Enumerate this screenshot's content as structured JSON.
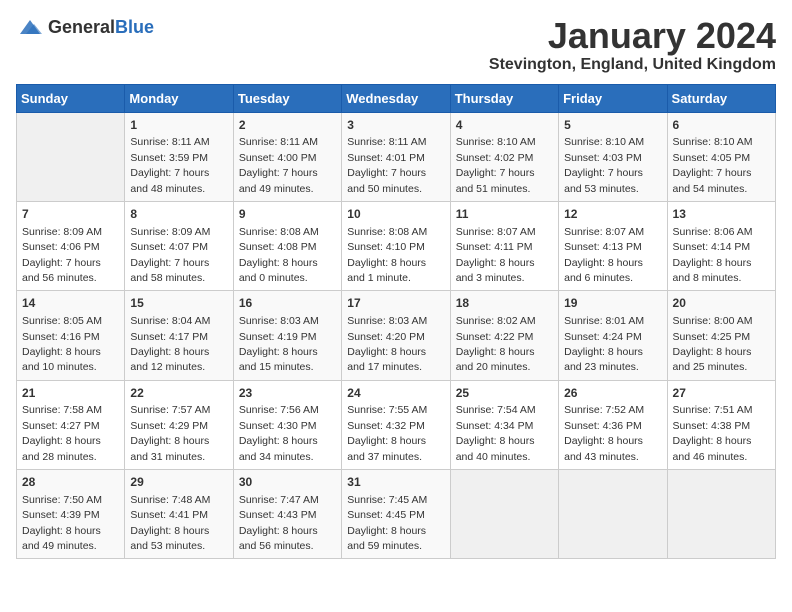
{
  "logo": {
    "general": "General",
    "blue": "Blue"
  },
  "header": {
    "month": "January 2024",
    "location": "Stevington, England, United Kingdom"
  },
  "days_of_week": [
    "Sunday",
    "Monday",
    "Tuesday",
    "Wednesday",
    "Thursday",
    "Friday",
    "Saturday"
  ],
  "weeks": [
    [
      {
        "day": "",
        "sunrise": "",
        "sunset": "",
        "daylight": ""
      },
      {
        "day": "1",
        "sunrise": "Sunrise: 8:11 AM",
        "sunset": "Sunset: 3:59 PM",
        "daylight": "Daylight: 7 hours and 48 minutes."
      },
      {
        "day": "2",
        "sunrise": "Sunrise: 8:11 AM",
        "sunset": "Sunset: 4:00 PM",
        "daylight": "Daylight: 7 hours and 49 minutes."
      },
      {
        "day": "3",
        "sunrise": "Sunrise: 8:11 AM",
        "sunset": "Sunset: 4:01 PM",
        "daylight": "Daylight: 7 hours and 50 minutes."
      },
      {
        "day": "4",
        "sunrise": "Sunrise: 8:10 AM",
        "sunset": "Sunset: 4:02 PM",
        "daylight": "Daylight: 7 hours and 51 minutes."
      },
      {
        "day": "5",
        "sunrise": "Sunrise: 8:10 AM",
        "sunset": "Sunset: 4:03 PM",
        "daylight": "Daylight: 7 hours and 53 minutes."
      },
      {
        "day": "6",
        "sunrise": "Sunrise: 8:10 AM",
        "sunset": "Sunset: 4:05 PM",
        "daylight": "Daylight: 7 hours and 54 minutes."
      }
    ],
    [
      {
        "day": "7",
        "sunrise": "Sunrise: 8:09 AM",
        "sunset": "Sunset: 4:06 PM",
        "daylight": "Daylight: 7 hours and 56 minutes."
      },
      {
        "day": "8",
        "sunrise": "Sunrise: 8:09 AM",
        "sunset": "Sunset: 4:07 PM",
        "daylight": "Daylight: 7 hours and 58 minutes."
      },
      {
        "day": "9",
        "sunrise": "Sunrise: 8:08 AM",
        "sunset": "Sunset: 4:08 PM",
        "daylight": "Daylight: 8 hours and 0 minutes."
      },
      {
        "day": "10",
        "sunrise": "Sunrise: 8:08 AM",
        "sunset": "Sunset: 4:10 PM",
        "daylight": "Daylight: 8 hours and 1 minute."
      },
      {
        "day": "11",
        "sunrise": "Sunrise: 8:07 AM",
        "sunset": "Sunset: 4:11 PM",
        "daylight": "Daylight: 8 hours and 3 minutes."
      },
      {
        "day": "12",
        "sunrise": "Sunrise: 8:07 AM",
        "sunset": "Sunset: 4:13 PM",
        "daylight": "Daylight: 8 hours and 6 minutes."
      },
      {
        "day": "13",
        "sunrise": "Sunrise: 8:06 AM",
        "sunset": "Sunset: 4:14 PM",
        "daylight": "Daylight: 8 hours and 8 minutes."
      }
    ],
    [
      {
        "day": "14",
        "sunrise": "Sunrise: 8:05 AM",
        "sunset": "Sunset: 4:16 PM",
        "daylight": "Daylight: 8 hours and 10 minutes."
      },
      {
        "day": "15",
        "sunrise": "Sunrise: 8:04 AM",
        "sunset": "Sunset: 4:17 PM",
        "daylight": "Daylight: 8 hours and 12 minutes."
      },
      {
        "day": "16",
        "sunrise": "Sunrise: 8:03 AM",
        "sunset": "Sunset: 4:19 PM",
        "daylight": "Daylight: 8 hours and 15 minutes."
      },
      {
        "day": "17",
        "sunrise": "Sunrise: 8:03 AM",
        "sunset": "Sunset: 4:20 PM",
        "daylight": "Daylight: 8 hours and 17 minutes."
      },
      {
        "day": "18",
        "sunrise": "Sunrise: 8:02 AM",
        "sunset": "Sunset: 4:22 PM",
        "daylight": "Daylight: 8 hours and 20 minutes."
      },
      {
        "day": "19",
        "sunrise": "Sunrise: 8:01 AM",
        "sunset": "Sunset: 4:24 PM",
        "daylight": "Daylight: 8 hours and 23 minutes."
      },
      {
        "day": "20",
        "sunrise": "Sunrise: 8:00 AM",
        "sunset": "Sunset: 4:25 PM",
        "daylight": "Daylight: 8 hours and 25 minutes."
      }
    ],
    [
      {
        "day": "21",
        "sunrise": "Sunrise: 7:58 AM",
        "sunset": "Sunset: 4:27 PM",
        "daylight": "Daylight: 8 hours and 28 minutes."
      },
      {
        "day": "22",
        "sunrise": "Sunrise: 7:57 AM",
        "sunset": "Sunset: 4:29 PM",
        "daylight": "Daylight: 8 hours and 31 minutes."
      },
      {
        "day": "23",
        "sunrise": "Sunrise: 7:56 AM",
        "sunset": "Sunset: 4:30 PM",
        "daylight": "Daylight: 8 hours and 34 minutes."
      },
      {
        "day": "24",
        "sunrise": "Sunrise: 7:55 AM",
        "sunset": "Sunset: 4:32 PM",
        "daylight": "Daylight: 8 hours and 37 minutes."
      },
      {
        "day": "25",
        "sunrise": "Sunrise: 7:54 AM",
        "sunset": "Sunset: 4:34 PM",
        "daylight": "Daylight: 8 hours and 40 minutes."
      },
      {
        "day": "26",
        "sunrise": "Sunrise: 7:52 AM",
        "sunset": "Sunset: 4:36 PM",
        "daylight": "Daylight: 8 hours and 43 minutes."
      },
      {
        "day": "27",
        "sunrise": "Sunrise: 7:51 AM",
        "sunset": "Sunset: 4:38 PM",
        "daylight": "Daylight: 8 hours and 46 minutes."
      }
    ],
    [
      {
        "day": "28",
        "sunrise": "Sunrise: 7:50 AM",
        "sunset": "Sunset: 4:39 PM",
        "daylight": "Daylight: 8 hours and 49 minutes."
      },
      {
        "day": "29",
        "sunrise": "Sunrise: 7:48 AM",
        "sunset": "Sunset: 4:41 PM",
        "daylight": "Daylight: 8 hours and 53 minutes."
      },
      {
        "day": "30",
        "sunrise": "Sunrise: 7:47 AM",
        "sunset": "Sunset: 4:43 PM",
        "daylight": "Daylight: 8 hours and 56 minutes."
      },
      {
        "day": "31",
        "sunrise": "Sunrise: 7:45 AM",
        "sunset": "Sunset: 4:45 PM",
        "daylight": "Daylight: 8 hours and 59 minutes."
      },
      {
        "day": "",
        "sunrise": "",
        "sunset": "",
        "daylight": ""
      },
      {
        "day": "",
        "sunrise": "",
        "sunset": "",
        "daylight": ""
      },
      {
        "day": "",
        "sunrise": "",
        "sunset": "",
        "daylight": ""
      }
    ]
  ]
}
